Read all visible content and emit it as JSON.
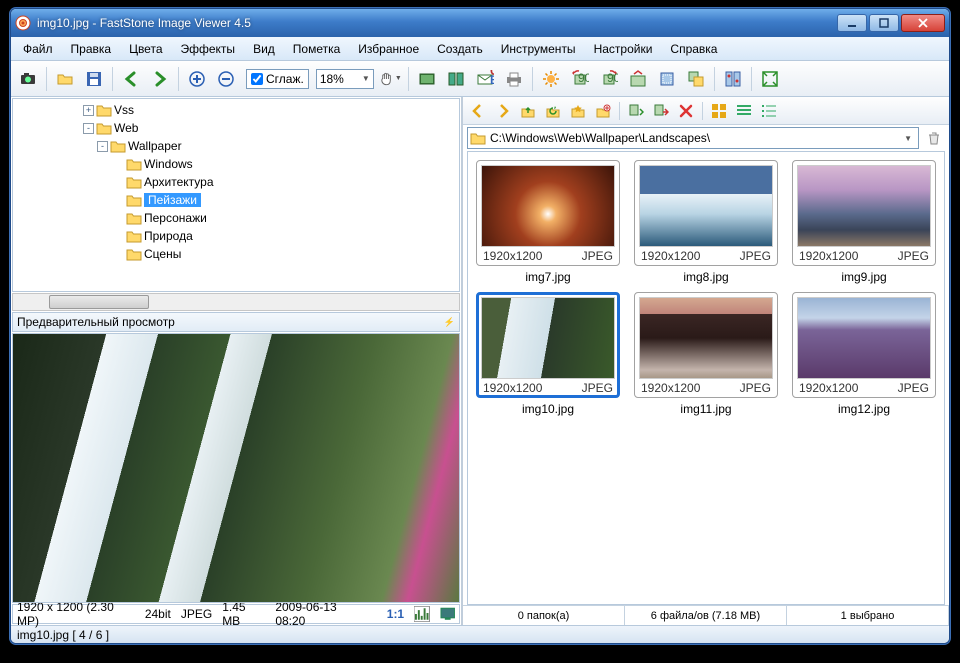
{
  "window": {
    "title": "img10.jpg  -  FastStone Image Viewer 4.5"
  },
  "menu": {
    "items": [
      "Файл",
      "Правка",
      "Цвета",
      "Эффекты",
      "Вид",
      "Пометка",
      "Избранное",
      "Создать",
      "Инструменты",
      "Настройки",
      "Справка"
    ]
  },
  "toolbar": {
    "smooth_label": "Сглаж.",
    "zoom_value": "18%"
  },
  "tree": {
    "items": [
      {
        "indent": 5,
        "expander": "+",
        "label": "Vss"
      },
      {
        "indent": 5,
        "expander": "-",
        "label": "Web"
      },
      {
        "indent": 6,
        "expander": "-",
        "label": "Wallpaper"
      },
      {
        "indent": 7,
        "expander": "",
        "label": "Windows"
      },
      {
        "indent": 7,
        "expander": "",
        "label": "Архитектура"
      },
      {
        "indent": 7,
        "expander": "",
        "label": "Пейзажи",
        "selected": true
      },
      {
        "indent": 7,
        "expander": "",
        "label": "Персонажи"
      },
      {
        "indent": 7,
        "expander": "",
        "label": "Природа"
      },
      {
        "indent": 7,
        "expander": "",
        "label": "Сцены"
      }
    ]
  },
  "preview": {
    "header": "Предварительный просмотр",
    "resolution": "1920 x 1200 (2.30 MP)",
    "depth": "24bit",
    "format": "JPEG",
    "size": "1.45 MB",
    "date": "2009-06-13 08:20",
    "ratio_label": "1:1"
  },
  "path": {
    "value": "C:\\Windows\\Web\\Wallpaper\\Landscapes\\"
  },
  "thumbs": [
    {
      "res": "1920x1200",
      "fmt": "JPEG",
      "name": "img7.jpg",
      "art": "canyon"
    },
    {
      "res": "1920x1200",
      "fmt": "JPEG",
      "name": "img8.jpg",
      "art": "iceberg"
    },
    {
      "res": "1920x1200",
      "fmt": "JPEG",
      "name": "img9.jpg",
      "art": "beach"
    },
    {
      "res": "1920x1200",
      "fmt": "JPEG",
      "name": "img10.jpg",
      "art": "waterfall",
      "selected": true
    },
    {
      "res": "1920x1200",
      "fmt": "JPEG",
      "name": "img11.jpg",
      "art": "arch"
    },
    {
      "res": "1920x1200",
      "fmt": "JPEG",
      "name": "img12.jpg",
      "art": "lavender"
    }
  ],
  "rightstatus": {
    "folders": "0 папок(а)",
    "files": "6 файла/ов (7.18 MB)",
    "selected": "1 выбрано"
  },
  "statusbar": "img10.jpg  [ 4 / 6 ]"
}
